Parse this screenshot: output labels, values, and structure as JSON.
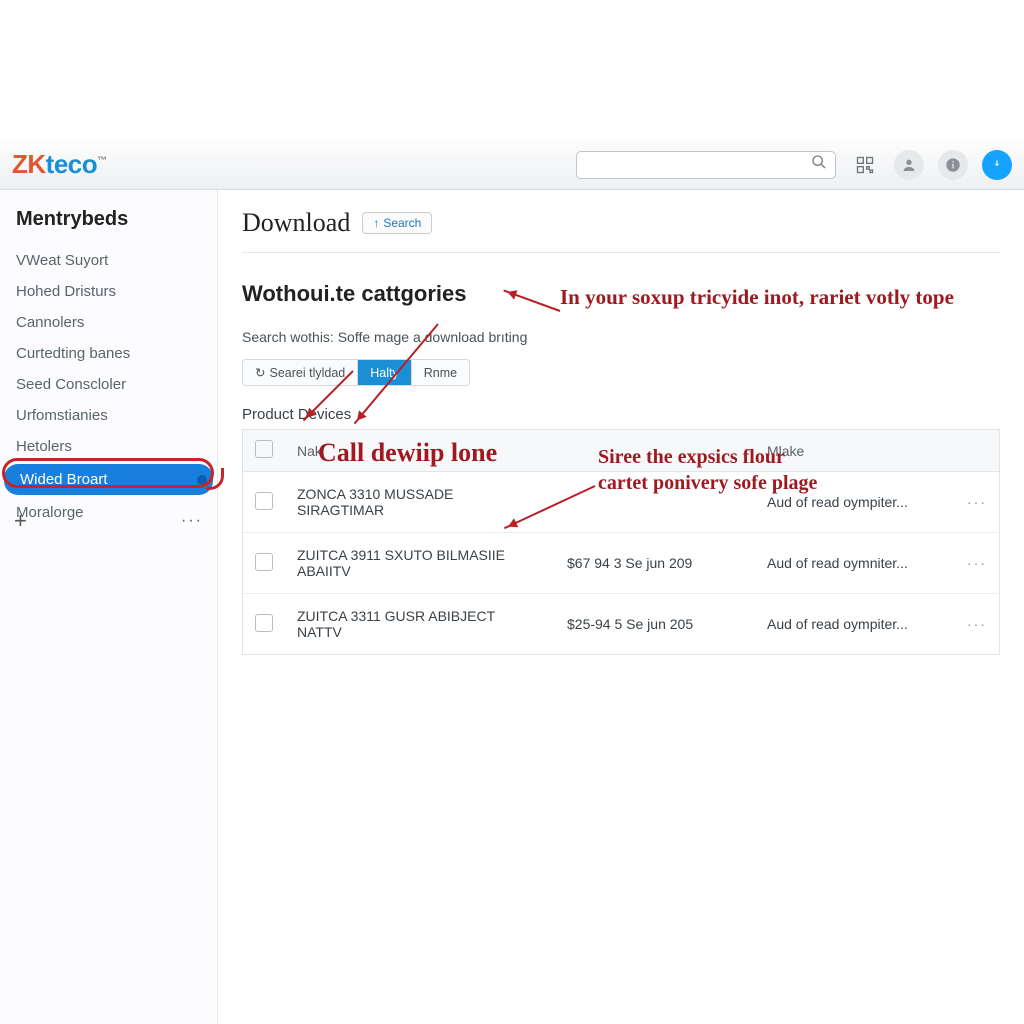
{
  "brand": {
    "z": "Z",
    "k": "K",
    "teco": "teco"
  },
  "header": {
    "search_placeholder": "",
    "icons": {
      "qr": "qr-icon",
      "user": "user-icon",
      "info": "info-icon",
      "download": "download-icon"
    }
  },
  "sidebar": {
    "title": "Mentrybeds",
    "items": [
      {
        "label": "VWeat Suyort"
      },
      {
        "label": "Hohed Dristurs"
      },
      {
        "label": "Cannolers"
      },
      {
        "label": "Curtedting banes"
      },
      {
        "label": "Seed Conscloler"
      },
      {
        "label": "Urfomstianies"
      },
      {
        "label": "Hetolers"
      },
      {
        "label": "Wided Broart"
      },
      {
        "label": "Moralorge"
      }
    ],
    "active_index": 7,
    "footer": {
      "plus": "+",
      "dots": "···"
    }
  },
  "main": {
    "title": "Download",
    "search_btn": "Search",
    "section_title": "Wothoui.te cattgories",
    "search_note_label": "Search wothis:",
    "search_note_value": "Soffe mage a download brıting",
    "tabs": [
      {
        "label": "Searei tlyldad",
        "icon": "↻"
      },
      {
        "label": "Halty"
      },
      {
        "label": "Rnme"
      }
    ],
    "active_tab": 1,
    "table_title": "Product Devices",
    "columns": {
      "c0": "",
      "c1": "Nak",
      "c2": "",
      "c3": "Mlake",
      "c4": ""
    },
    "rows": [
      {
        "name": "ZONCA 3310 MUSSADE SIRAGTIMAR",
        "mid": "",
        "make": "Aud of read oympiter..."
      },
      {
        "name": "ZUITCA 3911 SXUTO BILMASIIE ABAIITV",
        "mid": "$67 94 3 Se jun 209",
        "make": "Aud of read oymniter..."
      },
      {
        "name": "ZUITCA 3311 GUSR ABIBJECT NATTV",
        "mid": "$25-94 5 Se jun 205",
        "make": "Aud of read oympiter..."
      }
    ]
  },
  "annotations": {
    "a1": "In your soxup tricyide inot, rariet votly tope",
    "a2": "Call dewiip lone",
    "a3": "Siree the expsics flour cartet ponivery sofe plage"
  }
}
